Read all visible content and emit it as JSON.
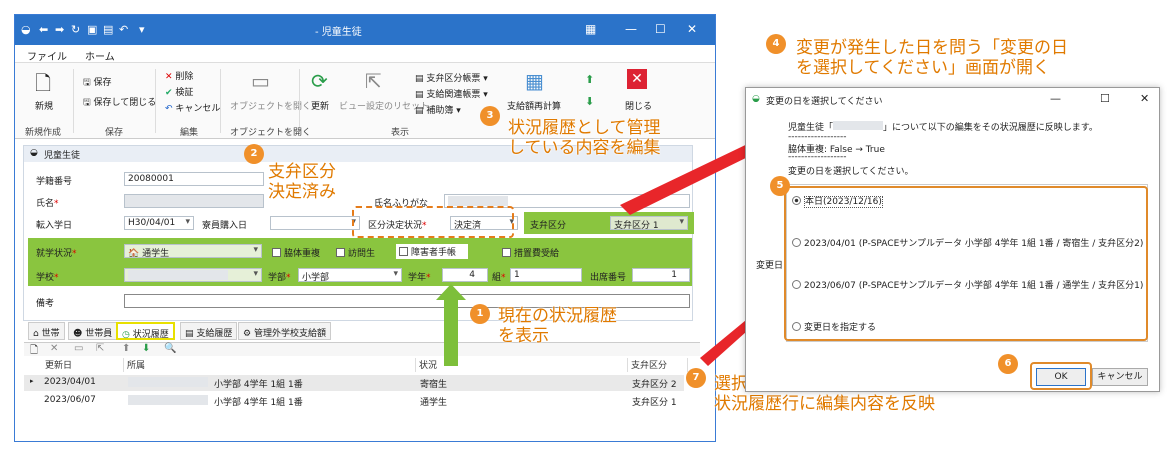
{
  "window": {
    "title": "- 児童生徒",
    "title_blurred_prefix": "",
    "menu": [
      "ファイル",
      "ホーム"
    ]
  },
  "ribbon": {
    "new_label": "新規",
    "save_label": "保存",
    "save_close_label": "保存して閉じる",
    "delete_label": "削除",
    "verify_label": "検証",
    "cancel_label": "キャンセル",
    "open_object_label": "オブジェクトを開く",
    "refresh_label": "更新",
    "view_reset_label": "ビュー設定のリセット",
    "report1_label": "支弁区分帳票",
    "report2_label": "支給関連帳票",
    "report3_label": "補助簿",
    "recalc_label": "支給額再計算",
    "close_label": "閉じる",
    "groups": [
      "新規作成",
      "保存",
      "編集",
      "オブジェクトを開く",
      "表示"
    ]
  },
  "form": {
    "panel_title": "児童生徒",
    "student_no_label": "学籍番号",
    "student_no": "20080001",
    "name_label": "氏名",
    "kana_label": "氏名ふりがな",
    "transfer_date_label": "転入学日",
    "transfer_date": "H30/04/01",
    "boarding_date_label": "寮員購入日",
    "decision_label": "区分決定状況",
    "decision_value": "決定済",
    "support_label": "支弁区分",
    "support_value": "支弁区分 1",
    "attendance_label": "就学状況",
    "attendance_value": "通学生",
    "chk_dorm": "脇体重複",
    "chk_visit": "訪問生",
    "chk_disability": "障害者手帳",
    "chk_measure": "措置費受給",
    "school_label": "学校",
    "dept_label": "学部",
    "dept_value": "小学部",
    "grade_label": "学年",
    "grade_value": "4",
    "class_label": "組",
    "class_value": "1",
    "seat_label": "出席番号",
    "seat_value": "1",
    "memo_label": "備考"
  },
  "tabs": [
    "世帯",
    "世帯員",
    "状況履歴",
    "支給履歴",
    "管理外学校支給額"
  ],
  "grid": {
    "headers": [
      "更新日",
      "所属",
      "状況",
      "支弁区分"
    ],
    "rows": [
      {
        "date": "2023/04/01",
        "belong": "小学部 4学年 1組 1番",
        "status": "寄宿生",
        "support": "支弁区分 2"
      },
      {
        "date": "2023/06/07",
        "belong": "小学部 4学年 1組 1番",
        "status": "通学生",
        "support": "支弁区分 1"
      }
    ]
  },
  "dialog": {
    "title": "変更の日を選択してください",
    "line1_pre": "児童生徒「",
    "line1_post": "」について以下の編集をその状況履歴に反映します。",
    "dash": "------------------",
    "change": "脇体重複: False → True",
    "prompt": "変更の日を選択してください。",
    "change_date_label": "変更日",
    "options": [
      "本日(2023/12/16)",
      "2023/04/01 (P-SPACEサンプルデータ 小学部 4学年 1組 1番 / 寄宿生 / 支弁区分2)",
      "2023/06/07 (P-SPACEサンプルデータ 小学部 4学年 1組 1番 / 通学生 / 支弁区分1)",
      "変更日を指定する"
    ],
    "ok_label": "OK",
    "cancel_label": "キャンセル"
  },
  "callouts": {
    "c1": "現在の状況履歴\nを表示",
    "c2": "支弁区分\n決定済み",
    "c3": "状況履歴として管理\nしている内容を編集",
    "c4": "変更が発生した日を問う「変更の日\nを選択してください」画面が開く",
    "c7": "選択された「変更日」の\n状況履歴行に編集内容を反映",
    "n1": "1",
    "n2": "2",
    "n3": "3",
    "n4": "4",
    "n5": "5",
    "n6": "6",
    "n7": "7"
  },
  "colors": {
    "titlebar": "#2b73c9",
    "green": "#8ac53f",
    "orange": "#e57c1a",
    "arrow_red": "#e8262a",
    "arrow_green": "#7dbf3a"
  }
}
